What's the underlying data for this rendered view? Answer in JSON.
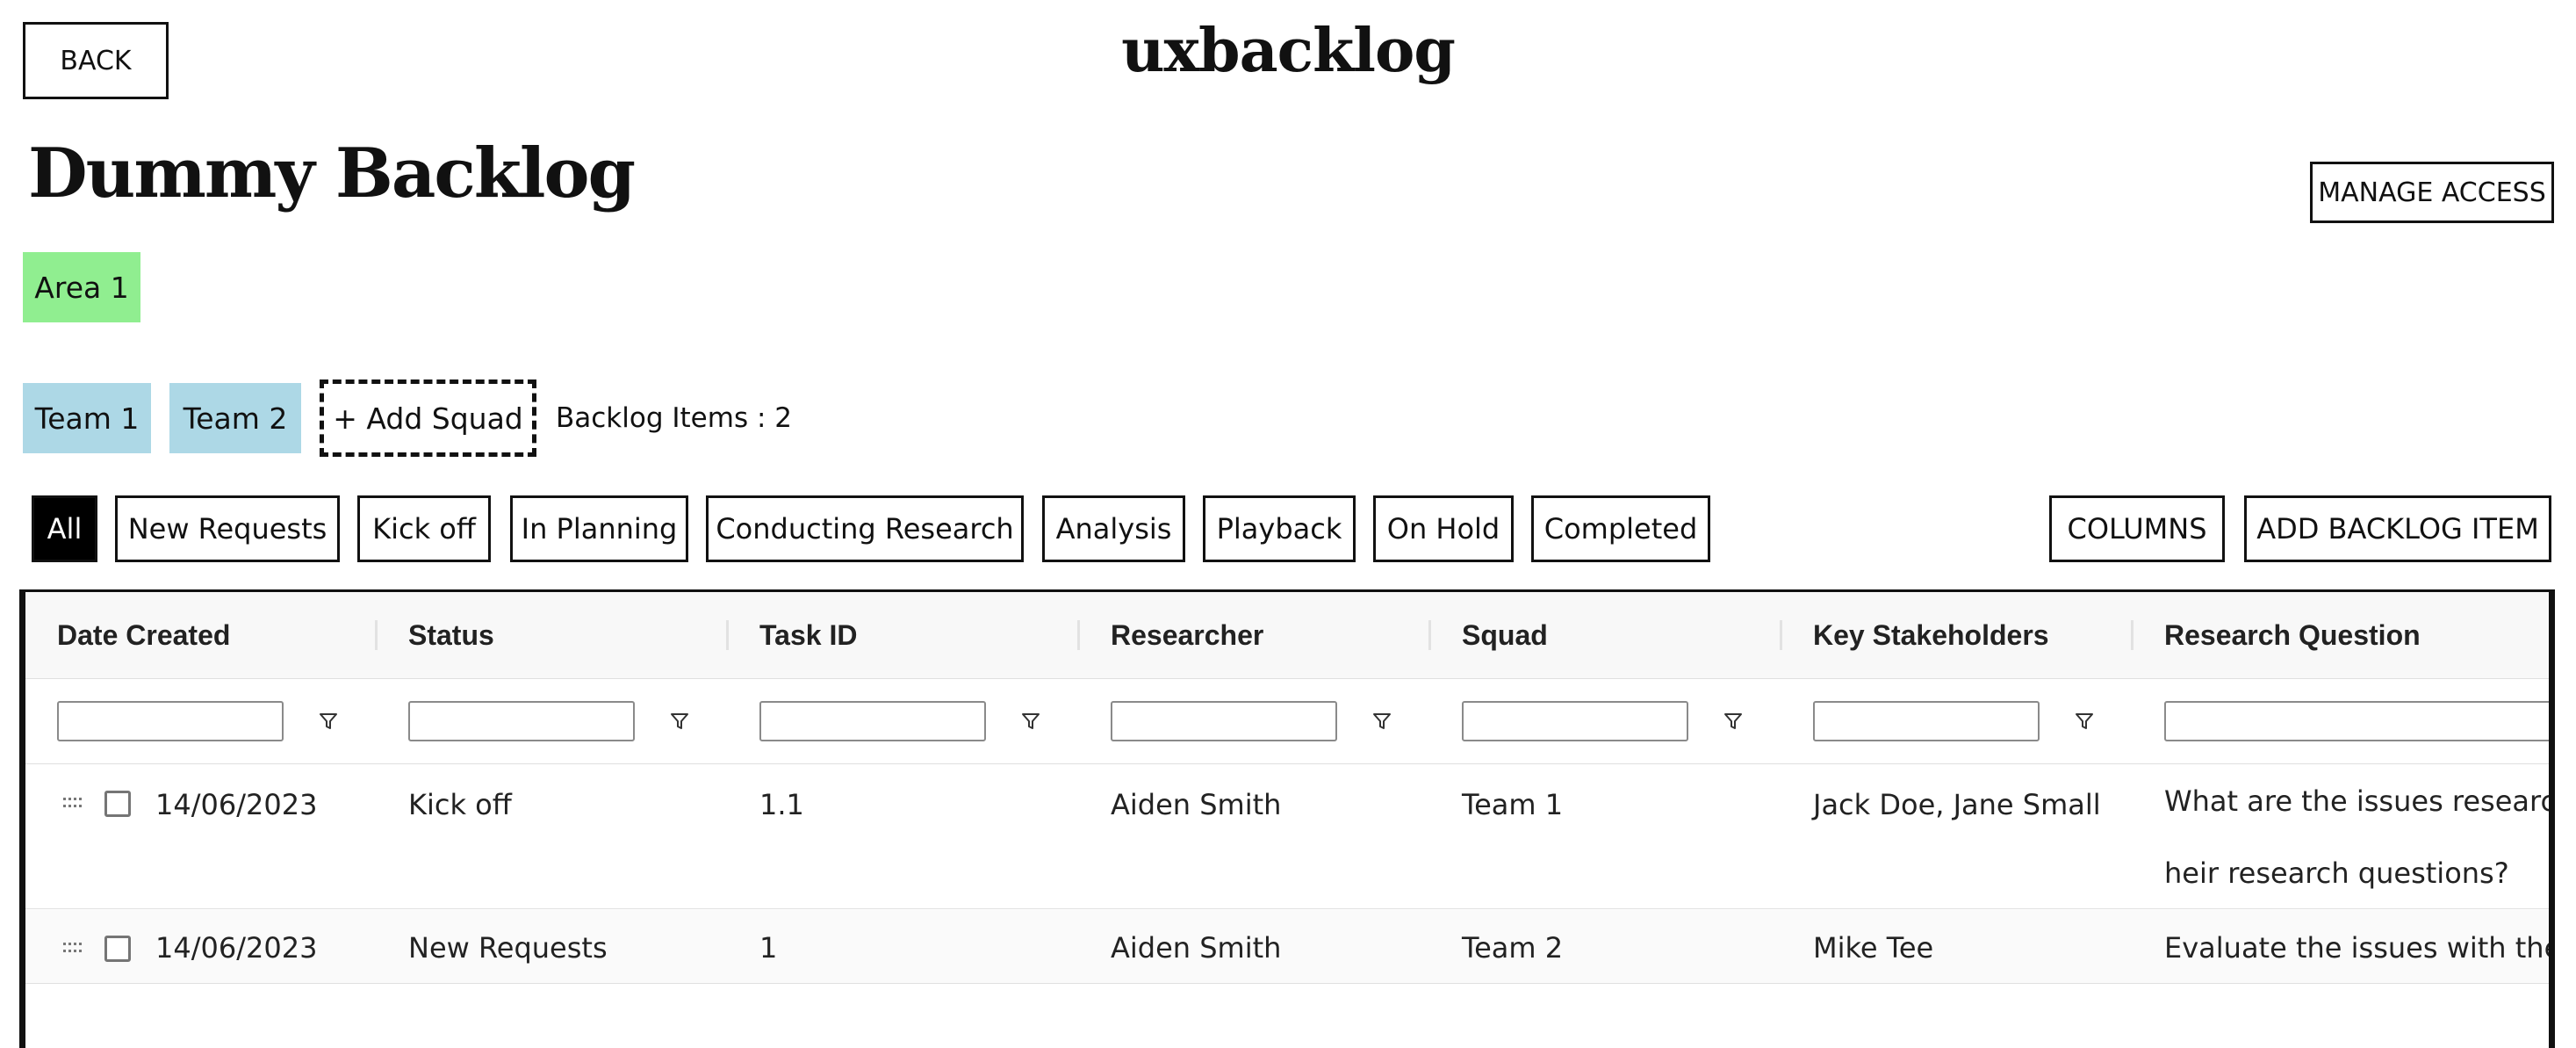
{
  "header": {
    "back_label": "BACK",
    "app_title": "uxbacklog",
    "page_title": "Dummy Backlog",
    "manage_access_label": "MANAGE ACCESS"
  },
  "areas": [
    {
      "label": "Area 1",
      "color": "#90ee90"
    }
  ],
  "squads": [
    {
      "label": "Team 1",
      "color": "#add8e6"
    },
    {
      "label": "Team 2",
      "color": "#add8e6"
    }
  ],
  "add_squad_label": "+ Add Squad",
  "backlog_count_label": "Backlog Items : 2",
  "status_filters": [
    {
      "label": "All",
      "active": true
    },
    {
      "label": "New Requests",
      "active": false
    },
    {
      "label": "Kick off",
      "active": false
    },
    {
      "label": "In Planning",
      "active": false
    },
    {
      "label": "Conducting Research",
      "active": false
    },
    {
      "label": "Analysis",
      "active": false
    },
    {
      "label": "Playback",
      "active": false
    },
    {
      "label": "On Hold",
      "active": false
    },
    {
      "label": "Completed",
      "active": false
    }
  ],
  "actions": {
    "columns_label": "COLUMNS",
    "add_item_label": "ADD BACKLOG ITEM"
  },
  "table": {
    "columns": [
      "Date Created",
      "Status",
      "Task ID",
      "Researcher",
      "Squad",
      "Key Stakeholders",
      "Research Question"
    ],
    "rows": [
      {
        "date": "14/06/2023",
        "status": "Kick off",
        "task_id": "1.1",
        "researcher": "Aiden Smith",
        "squad": "Team 1",
        "stakeholders": "Jack Doe, Jane Small",
        "question_line1": "What are the issues research",
        "question_line2": "heir research questions?"
      },
      {
        "date": "14/06/2023",
        "status": "New Requests",
        "task_id": "1",
        "researcher": "Aiden Smith",
        "squad": "Team 2",
        "stakeholders": "Mike Tee",
        "question_line1": "Evaluate the issues with the f"
      }
    ]
  },
  "icons": {
    "filter": "filter-funnel-icon",
    "drag": "drag-handle-icon",
    "checkbox": "checkbox-icon"
  }
}
